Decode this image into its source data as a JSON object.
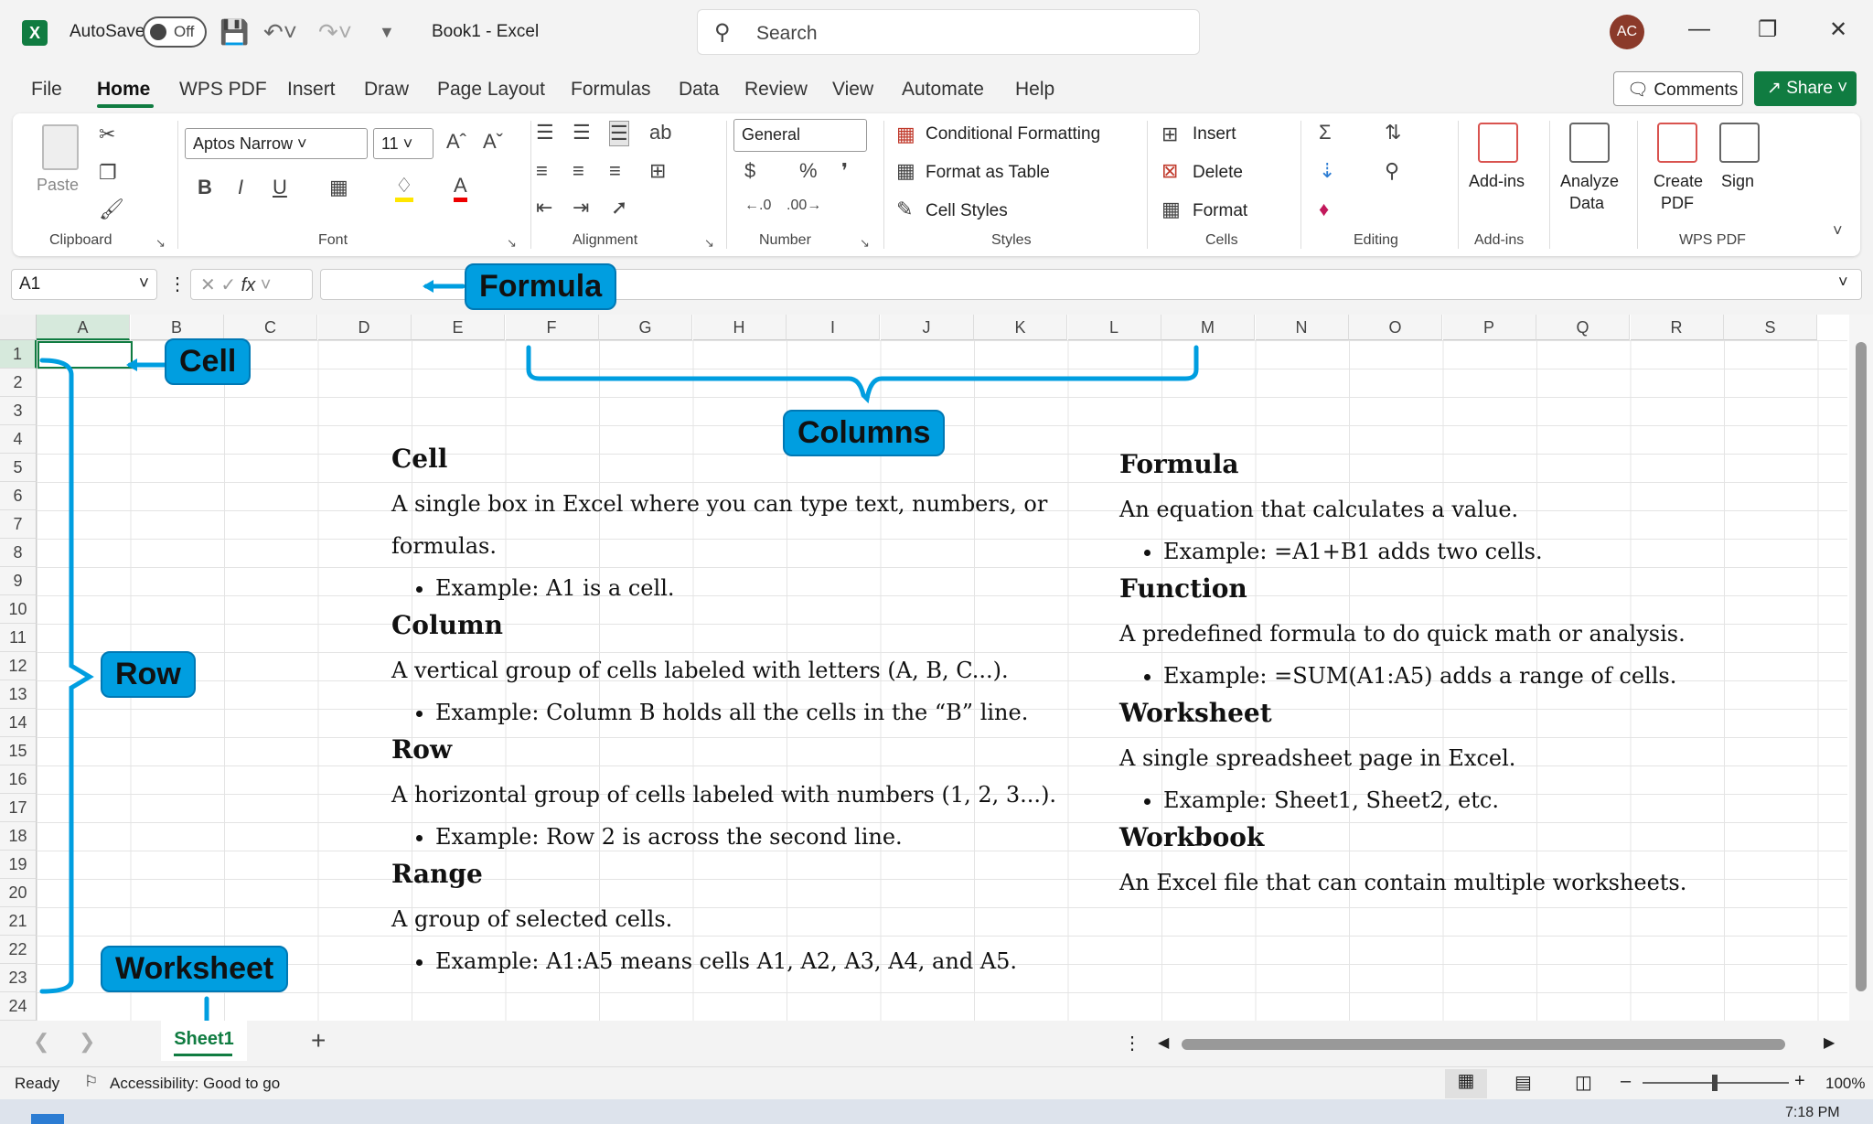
{
  "titlebar": {
    "autosave_label": "AutoSave",
    "toggle_state": "Off",
    "doc_title": "Book1  -  Excel",
    "search_placeholder": "Search",
    "avatar_initials": "AC"
  },
  "tabs": [
    "File",
    "Home",
    "WPS PDF",
    "Insert",
    "Draw",
    "Page Layout",
    "Formulas",
    "Data",
    "Review",
    "View",
    "Automate",
    "Help"
  ],
  "actions": {
    "comments": "Comments",
    "share": "Share"
  },
  "ribbon": {
    "clipboard": {
      "label": "Clipboard",
      "paste": "Paste"
    },
    "font": {
      "label": "Font",
      "family": "Aptos Narrow",
      "size": "11"
    },
    "alignment": {
      "label": "Alignment"
    },
    "number": {
      "label": "Number",
      "format": "General"
    },
    "styles": {
      "label": "Styles",
      "conditional": "Conditional Formatting",
      "format_table": "Format as Table",
      "cell_styles": "Cell Styles"
    },
    "cells": {
      "label": "Cells",
      "insert": "Insert",
      "delete": "Delete",
      "format": "Format"
    },
    "editing": {
      "label": "Editing"
    },
    "addins": {
      "label": "Add-ins",
      "btn": "Add-ins"
    },
    "analyze": {
      "line1": "Analyze",
      "line2": "Data"
    },
    "wps": {
      "label": "WPS PDF",
      "create1": "Create",
      "create2": "PDF",
      "sign": "Sign"
    }
  },
  "formula_bar": {
    "namebox": "A1",
    "fx": "fx"
  },
  "columns": [
    "A",
    "B",
    "C",
    "D",
    "E",
    "F",
    "G",
    "H",
    "I",
    "J",
    "K",
    "L",
    "M",
    "N",
    "O",
    "P",
    "Q",
    "R",
    "S"
  ],
  "rows": [
    "1",
    "2",
    "3",
    "4",
    "5",
    "6",
    "7",
    "8",
    "9",
    "10",
    "11",
    "12",
    "13",
    "14",
    "15",
    "16",
    "17",
    "18",
    "19",
    "20",
    "21",
    "22",
    "23",
    "24"
  ],
  "callouts": {
    "formula": "Formula",
    "cell": "Cell",
    "columns": "Columns",
    "row": "Row",
    "worksheet": "Worksheet"
  },
  "left_content": {
    "cell_h": "Cell",
    "cell_p": "A single box in Excel where you can type text, numbers, or formulas.",
    "cell_li": "Example: A1 is a cell.",
    "column_h": "Column",
    "column_p": "A vertical group of cells labeled with letters (A, B, C...).",
    "column_li": "Example: Column B holds all the cells in the “B” line.",
    "row_h": "Row",
    "row_p": "A horizontal group of cells labeled with numbers (1, 2, 3...).",
    "row_li": "Example: Row 2 is across the second line.",
    "range_h": "Range",
    "range_p": "A group of selected cells.",
    "range_li": "Example: A1:A5 means cells A1, A2, A3, A4, and A5."
  },
  "right_content": {
    "formula_h": "Formula",
    "formula_p": "An equation that calculates a value.",
    "formula_li": "Example: =A1+B1 adds two cells.",
    "function_h": "Function",
    "function_p": "A predefined formula to do quick math or analysis.",
    "function_li": "Example: =SUM(A1:A5) adds a range of cells.",
    "worksheet_h": "Worksheet",
    "worksheet_p": "A single spreadsheet page in Excel.",
    "worksheet_li": "Example: Sheet1, Sheet2, etc.",
    "workbook_h": "Workbook",
    "workbook_p": "An Excel file that can contain multiple worksheets."
  },
  "sheet": {
    "tab": "Sheet1",
    "add": "+"
  },
  "status": {
    "ready": "Ready",
    "accessibility": "Accessibility: Good to go",
    "zoom": "100%"
  },
  "clock": "7:18 PM"
}
